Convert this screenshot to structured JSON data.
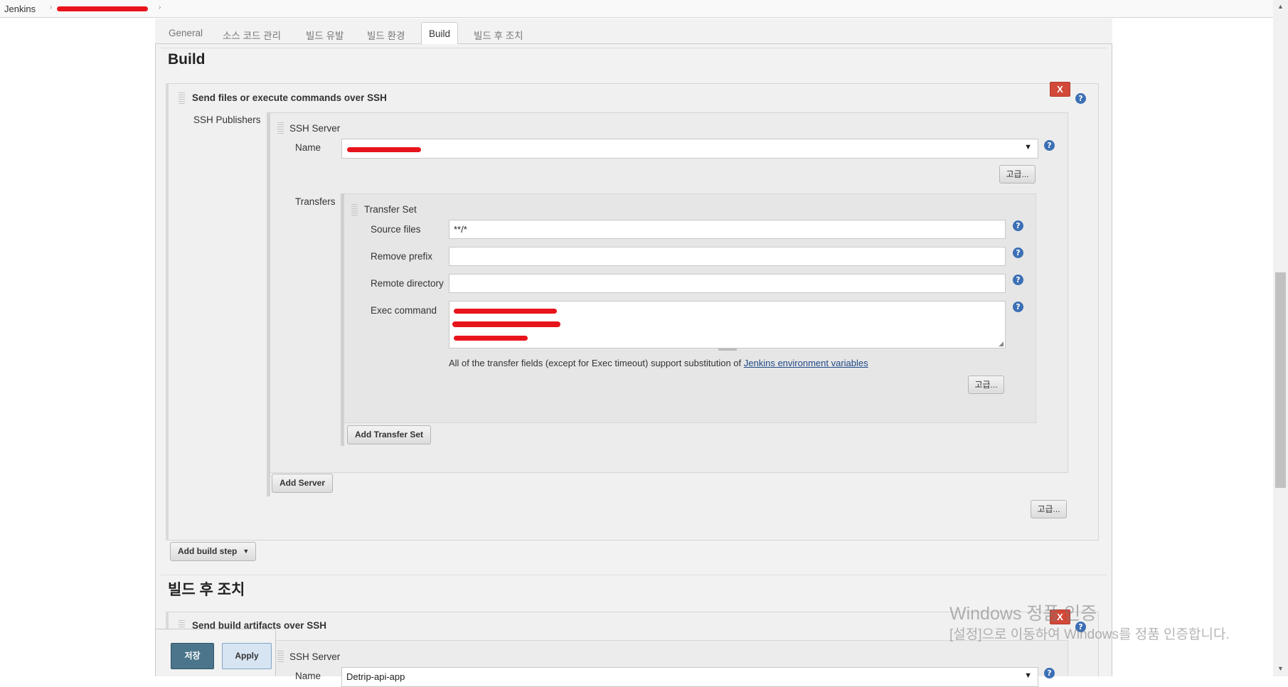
{
  "breadcrumb": {
    "root": "Jenkins"
  },
  "tabs": [
    "General",
    "소스 코드 관리",
    "빌드 유발",
    "빌드 환경",
    "Build",
    "빌드 후 조치"
  ],
  "build_section": {
    "title": "Build",
    "step_title": "Send files or execute commands over SSH",
    "delete_label": "X",
    "publishers_label": "SSH Publishers",
    "server_label": "SSH Server",
    "name_label": "Name",
    "advanced_label": "고급...",
    "transfers_label": "Transfers",
    "transfer_set_label": "Transfer Set",
    "source_files_label": "Source files",
    "source_files_value": "**/*",
    "remove_prefix_label": "Remove prefix",
    "remove_prefix_value": "",
    "remote_directory_label": "Remote directory",
    "remote_directory_value": "",
    "exec_command_label": "Exec command",
    "substitution_note": "All of the transfer fields (except for Exec timeout) support substitution of",
    "env_vars_link": "Jenkins environment variables",
    "add_transfer_set": "Add Transfer Set",
    "add_server": "Add Server",
    "add_build_step": "Add build step"
  },
  "post_build_section": {
    "title": "빌드 후 조치",
    "step_title": "Send build artifacts over SSH",
    "delete_label": "X",
    "server_label": "SSH Server",
    "name_label": "Name",
    "name_value": "Detrip-api-app"
  },
  "footer": {
    "save_label": "저장",
    "apply_label": "Apply"
  },
  "watermark": {
    "line1": "Windows 정품 인증",
    "line2": "[설정]으로 이동하여 Windows를 정품 인증합니다."
  },
  "colors": {
    "delete_button": "#d24939",
    "save_button": "#4b758b",
    "help_icon": "#3b6fb5",
    "redaction": "#e8141c"
  }
}
